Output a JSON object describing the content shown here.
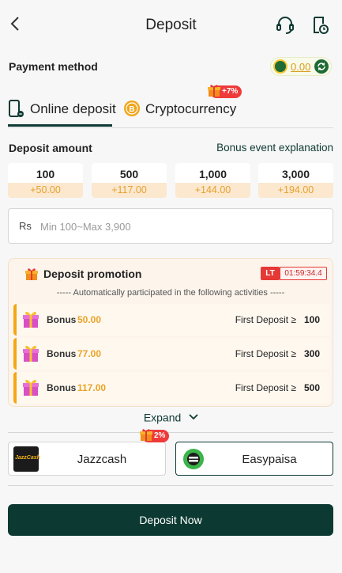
{
  "header": {
    "title": "Deposit"
  },
  "payment_method": {
    "label": "Payment method",
    "balance": "0.00"
  },
  "tabs": [
    {
      "label": "Online deposit",
      "active": true
    },
    {
      "label": "Cryptocurrency",
      "badge": "+7%"
    }
  ],
  "deposit_amount": {
    "label": "Deposit amount",
    "bonus_link": "Bonus event explanation",
    "options": [
      {
        "amount": "100",
        "bonus": "+50.00"
      },
      {
        "amount": "500",
        "bonus": "+117.00"
      },
      {
        "amount": "1,000",
        "bonus": "+144.00"
      },
      {
        "amount": "3,000",
        "bonus": "+194.00"
      }
    ]
  },
  "amount_input": {
    "currency": "Rs",
    "placeholder": "Min 100~Max 3,900"
  },
  "promotion": {
    "title": "Deposit promotion",
    "timer_badge": "LT",
    "timer": "01:59:34.4",
    "subtitle": "----- Automatically participated in the following activities -----",
    "rows": [
      {
        "label": "Bonus",
        "amount": "50.00",
        "condition": "First Deposit ≥",
        "value": "100"
      },
      {
        "label": "Bonus",
        "amount": "77.00",
        "condition": "First Deposit ≥",
        "value": "300"
      },
      {
        "label": "Bonus",
        "amount": "117.00",
        "condition": "First Deposit ≥",
        "value": "500"
      }
    ]
  },
  "expand_label": "Expand",
  "channels": [
    {
      "name": "Jazzcash",
      "logo_text": "JazzCash",
      "badge": "2%"
    },
    {
      "name": "Easypaisa",
      "selected": true
    }
  ],
  "submit_label": "Deposit Now",
  "colors": {
    "primary": "#0c3a32",
    "accent": "#e9a326",
    "badge": "#ef3a3a"
  }
}
